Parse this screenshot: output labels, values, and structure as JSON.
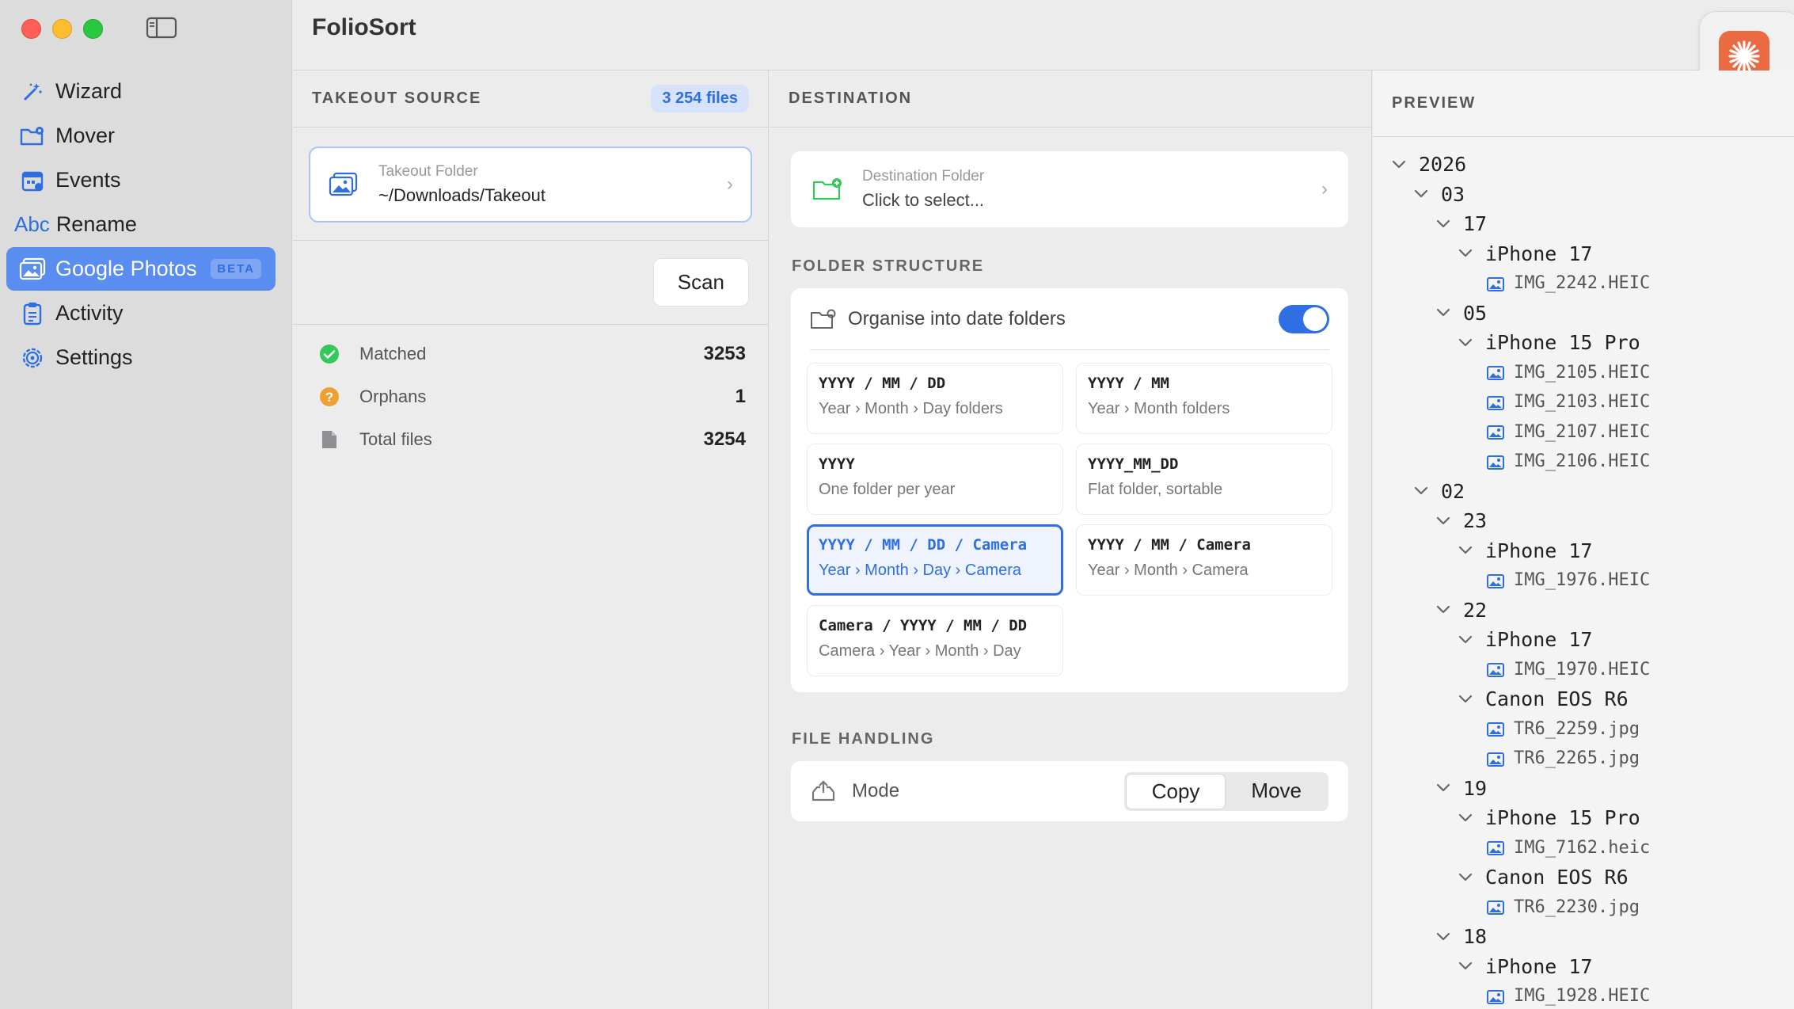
{
  "app": {
    "title": "FolioSort"
  },
  "sidebar": {
    "items": [
      {
        "label": "Wizard",
        "icon": "wand-icon"
      },
      {
        "label": "Mover",
        "icon": "folder-gear-icon"
      },
      {
        "label": "Events",
        "icon": "calendar-icon"
      },
      {
        "label": "Rename",
        "icon": "abc-icon",
        "prefix": "Abc"
      },
      {
        "label": "Google Photos",
        "icon": "photos-icon",
        "badge": "BETA",
        "active": true
      },
      {
        "label": "Activity",
        "icon": "clipboard-icon"
      },
      {
        "label": "Settings",
        "icon": "gear-icon"
      }
    ]
  },
  "source": {
    "header": "TAKEOUT SOURCE",
    "count": "3 254 files",
    "card_label": "Takeout Folder",
    "card_value": "~/Downloads/Takeout",
    "scan_label": "Scan",
    "stats": [
      {
        "label": "Matched",
        "value": "3253",
        "icon": "check-circle-icon",
        "color": "#34c759"
      },
      {
        "label": "Orphans",
        "value": "1",
        "icon": "question-circle-icon",
        "color": "#f0a030"
      },
      {
        "label": "Total files",
        "value": "3254",
        "icon": "document-icon",
        "color": "#8e8e93"
      }
    ]
  },
  "destination": {
    "header": "DESTINATION",
    "card_label": "Destination Folder",
    "card_value": "Click to select...",
    "structure_label": "FOLDER STRUCTURE",
    "toggle_label": "Organise into date folders",
    "toggle_on": true,
    "options": [
      {
        "pattern": "YYYY / MM / DD",
        "desc": "Year › Month › Day folders"
      },
      {
        "pattern": "YYYY / MM",
        "desc": "Year › Month folders"
      },
      {
        "pattern": "YYYY",
        "desc": "One folder per year"
      },
      {
        "pattern": "YYYY_MM_DD",
        "desc": "Flat folder, sortable"
      },
      {
        "pattern": "YYYY / MM / DD / Camera",
        "desc": "Year › Month › Day › Camera",
        "selected": true
      },
      {
        "pattern": "YYYY / MM / Camera",
        "desc": "Year › Month › Camera"
      },
      {
        "pattern": "Camera / YYYY / MM / DD",
        "desc": "Camera › Year › Month › Day"
      }
    ],
    "file_handling_label": "FILE HANDLING",
    "mode_label": "Mode",
    "mode_options": [
      "Copy",
      "Move"
    ],
    "mode_selected": "Copy"
  },
  "preview": {
    "header": "PREVIEW",
    "tree": [
      {
        "label": "2026",
        "depth": 0,
        "type": "folder"
      },
      {
        "label": "03",
        "depth": 1,
        "type": "folder"
      },
      {
        "label": "17",
        "depth": 2,
        "type": "folder"
      },
      {
        "label": "iPhone 17",
        "depth": 3,
        "type": "folder"
      },
      {
        "label": "IMG_2242.HEIC",
        "depth": 4,
        "type": "file"
      },
      {
        "label": "05",
        "depth": 2,
        "type": "folder"
      },
      {
        "label": "iPhone 15 Pro",
        "depth": 3,
        "type": "folder"
      },
      {
        "label": "IMG_2105.HEIC",
        "depth": 4,
        "type": "file"
      },
      {
        "label": "IMG_2103.HEIC",
        "depth": 4,
        "type": "file"
      },
      {
        "label": "IMG_2107.HEIC",
        "depth": 4,
        "type": "file"
      },
      {
        "label": "IMG_2106.HEIC",
        "depth": 4,
        "type": "file"
      },
      {
        "label": "02",
        "depth": 1,
        "type": "folder"
      },
      {
        "label": "23",
        "depth": 2,
        "type": "folder"
      },
      {
        "label": "iPhone 17",
        "depth": 3,
        "type": "folder"
      },
      {
        "label": "IMG_1976.HEIC",
        "depth": 4,
        "type": "file"
      },
      {
        "label": "22",
        "depth": 2,
        "type": "folder"
      },
      {
        "label": "iPhone 17",
        "depth": 3,
        "type": "folder"
      },
      {
        "label": "IMG_1970.HEIC",
        "depth": 4,
        "type": "file"
      },
      {
        "label": "Canon EOS R6",
        "depth": 3,
        "type": "folder"
      },
      {
        "label": "TR6_2259.jpg",
        "depth": 4,
        "type": "file"
      },
      {
        "label": "TR6_2265.jpg",
        "depth": 4,
        "type": "file"
      },
      {
        "label": "19",
        "depth": 2,
        "type": "folder"
      },
      {
        "label": "iPhone 15 Pro",
        "depth": 3,
        "type": "folder"
      },
      {
        "label": "IMG_7162.heic",
        "depth": 4,
        "type": "file"
      },
      {
        "label": "Canon EOS R6",
        "depth": 3,
        "type": "folder"
      },
      {
        "label": "TR6_2230.jpg",
        "depth": 4,
        "type": "file"
      },
      {
        "label": "18",
        "depth": 2,
        "type": "folder"
      },
      {
        "label": "iPhone 17",
        "depth": 3,
        "type": "folder"
      },
      {
        "label": "IMG_1928.HEIC",
        "depth": 4,
        "type": "file"
      }
    ]
  },
  "colors": {
    "accent": "#2f6fe3",
    "sidebar_active": "#5a8df0",
    "app_icon": "#ea6a42"
  }
}
